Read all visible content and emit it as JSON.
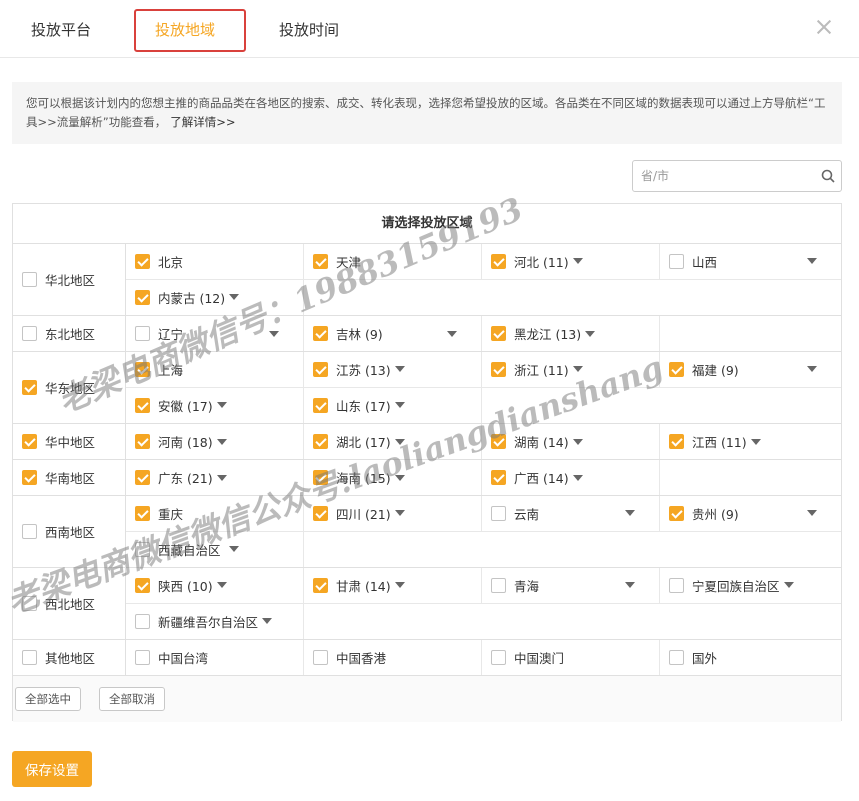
{
  "tabs": [
    {
      "label": "投放平台",
      "active": false
    },
    {
      "label": "投放地域",
      "active": true
    },
    {
      "label": "投放时间",
      "active": false
    }
  ],
  "info": {
    "text": "您可以根据该计划内的您想主推的商品品类在各地区的搜索、成交、转化表现，选择您希望投放的区域。各品类在不同区域的数据表现可以通过上方导航栏“工具>>流量解析”功能查看，",
    "more_link": "了解详情>>"
  },
  "search": {
    "placeholder": "省/市"
  },
  "region": {
    "title": "请选择投放区域",
    "groups": [
      {
        "name": "华北地区",
        "checked": false,
        "rows": [
          [
            {
              "name": "北京",
              "checked": true,
              "caret": false
            },
            {
              "name": "天津",
              "checked": true,
              "caret": false
            },
            {
              "name": "河北 (11)",
              "checked": true,
              "caret": true
            },
            {
              "name": "山西",
              "checked": false,
              "caret": true
            }
          ],
          [
            {
              "name": "内蒙古 (12)",
              "checked": true,
              "caret": true
            }
          ]
        ]
      },
      {
        "name": "东北地区",
        "checked": false,
        "rows": [
          [
            {
              "name": "辽宁",
              "checked": false,
              "caret": true
            },
            {
              "name": "吉林 (9)",
              "checked": true,
              "caret": true
            },
            {
              "name": "黑龙江 (13)",
              "checked": true,
              "caret": true
            }
          ]
        ]
      },
      {
        "name": "华东地区",
        "checked": true,
        "rows": [
          [
            {
              "name": "上海",
              "checked": true,
              "caret": false
            },
            {
              "name": "江苏 (13)",
              "checked": true,
              "caret": true
            },
            {
              "name": "浙江 (11)",
              "checked": true,
              "caret": true
            },
            {
              "name": "福建 (9)",
              "checked": true,
              "caret": true
            }
          ],
          [
            {
              "name": "安徽 (17)",
              "checked": true,
              "caret": true
            },
            {
              "name": "山东 (17)",
              "checked": true,
              "caret": true
            }
          ]
        ]
      },
      {
        "name": "华中地区",
        "checked": true,
        "rows": [
          [
            {
              "name": "河南 (18)",
              "checked": true,
              "caret": true
            },
            {
              "name": "湖北 (17)",
              "checked": true,
              "caret": true
            },
            {
              "name": "湖南 (14)",
              "checked": true,
              "caret": true
            },
            {
              "name": "江西 (11)",
              "checked": true,
              "caret": true
            }
          ]
        ]
      },
      {
        "name": "华南地区",
        "checked": true,
        "rows": [
          [
            {
              "name": "广东 (21)",
              "checked": true,
              "caret": true
            },
            {
              "name": "海南 (15)",
              "checked": true,
              "caret": true
            },
            {
              "name": "广西 (14)",
              "checked": true,
              "caret": true
            }
          ]
        ]
      },
      {
        "name": "西南地区",
        "checked": false,
        "rows": [
          [
            {
              "name": "重庆",
              "checked": true,
              "caret": false
            },
            {
              "name": "四川 (21)",
              "checked": true,
              "caret": true
            },
            {
              "name": "云南",
              "checked": false,
              "caret": true
            },
            {
              "name": "贵州 (9)",
              "checked": true,
              "caret": true
            }
          ],
          [
            {
              "name": "西藏自治区",
              "checked": false,
              "caret": true
            }
          ]
        ]
      },
      {
        "name": "西北地区",
        "checked": false,
        "rows": [
          [
            {
              "name": "陕西 (10)",
              "checked": true,
              "caret": true
            },
            {
              "name": "甘肃 (14)",
              "checked": true,
              "caret": true
            },
            {
              "name": "青海",
              "checked": false,
              "caret": true
            },
            {
              "name": "宁夏回族自治区",
              "checked": false,
              "caret": true
            }
          ],
          [
            {
              "name": "新疆维吾尔自治区",
              "checked": false,
              "caret": true
            }
          ]
        ]
      },
      {
        "name": "其他地区",
        "checked": false,
        "rows": [
          [
            {
              "name": "中国台湾",
              "checked": false,
              "caret": false
            },
            {
              "name": "中国香港",
              "checked": false,
              "caret": false
            },
            {
              "name": "中国澳门",
              "checked": false,
              "caret": false
            },
            {
              "name": "国外",
              "checked": false,
              "caret": false
            }
          ]
        ]
      }
    ],
    "select_all_label": "全部选中",
    "deselect_all_label": "全部取消"
  },
  "save_label": "保存设置",
  "watermark": {
    "line1": "老梁电商微信号：19883159193",
    "line2": "老梁电商微信微信公众号:laoliangdianshang"
  },
  "colors": {
    "accent": "#f5a623",
    "highlight_border": "#d9413c"
  }
}
